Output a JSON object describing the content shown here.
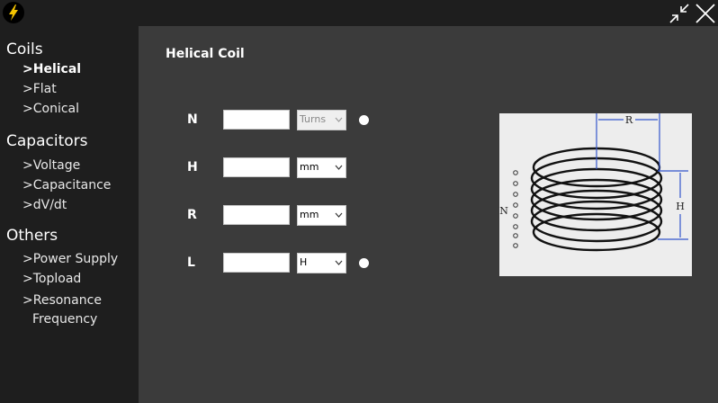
{
  "sidebar": {
    "sections": [
      {
        "title": "Coils",
        "items": [
          "Helical",
          "Flat",
          "Conical"
        ]
      },
      {
        "title": "Capacitors",
        "items": [
          "Voltage",
          "Capacitance",
          "dV/dt"
        ]
      },
      {
        "title": "Others",
        "items": [
          "Power Supply",
          "Topload",
          "Resonance",
          "Frequency"
        ]
      }
    ],
    "prefix": ">"
  },
  "main": {
    "title": "Helical Coil",
    "rows": [
      {
        "label": "N",
        "value": "",
        "unit": "Turns",
        "unit_disabled": true,
        "radio": true
      },
      {
        "label": "H",
        "value": "",
        "unit": "mm",
        "unit_disabled": false,
        "radio": false
      },
      {
        "label": "R",
        "value": "",
        "unit": "mm",
        "unit_disabled": false,
        "radio": false
      },
      {
        "label": "L",
        "value": "",
        "unit": "H",
        "unit_disabled": false,
        "radio": true
      }
    ]
  },
  "diagram": {
    "label_r": "R",
    "label_h": "H",
    "label_n": "N"
  },
  "colors": {
    "sidebar_bg": "#1e1e1e",
    "main_bg": "#3b3b3b",
    "icon_bolt": "#f5c400",
    "diagram_line": "#3355cc"
  }
}
